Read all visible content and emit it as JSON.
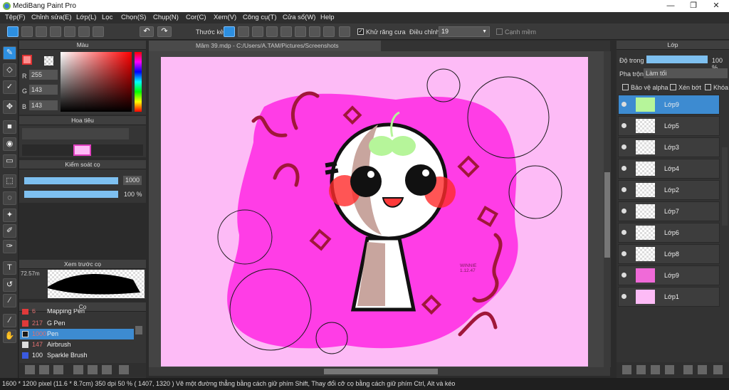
{
  "window": {
    "title": "MediBang Paint Pro",
    "min": "—",
    "max": "❐",
    "close": "✕"
  },
  "menu": [
    "Tệp(F)",
    "Chỉnh sửa(E)",
    "Lớp(L)",
    "Lọc",
    "Chọn(S)",
    "Chụp(N)",
    "Cor(C)",
    "Xem(V)",
    "Công cụ(T)",
    "Cửa sổ(W)",
    "Help"
  ],
  "toolbar": {
    "ruler_label": "Thước kẻ",
    "antialias_label": "Khử răng cưa",
    "correction_label": "Điều chỉnh",
    "correction_value": "19",
    "snap_label": "Cạnh mềm"
  },
  "color_panel": {
    "title": "Màu",
    "r_label": "R",
    "g_label": "G",
    "b_label": "B",
    "r": "255",
    "g": "143",
    "b": "143",
    "main_color": "#ff8f8f"
  },
  "navigator": {
    "title": "Hoa tiêu"
  },
  "brush_control": {
    "title": "Kiểm soát cọ",
    "size": "1000",
    "opacity": "100 %"
  },
  "brush_preview": {
    "title": "Xem trước cọ",
    "size": "72.57m"
  },
  "brush_panel": {
    "title": "Cọ",
    "items": [
      {
        "size": "6",
        "name": "Mapping Pen",
        "color": "#e03a3a"
      },
      {
        "size": "217",
        "name": "G Pen",
        "color": "#e03a3a"
      },
      {
        "size": "1000",
        "name": "Pen",
        "color": "#1b1b1b"
      },
      {
        "size": "147",
        "name": "Airbrush",
        "color": "#dddddd"
      },
      {
        "size": "100",
        "name": "Sparkle Brush",
        "color": "#3a5ae0"
      }
    ]
  },
  "document": {
    "tab": "Mâm 39.mdp - C:/Users/A.TAM/Pictures/Screenshots",
    "signature": "WINNIE 1.12.47"
  },
  "layers_panel": {
    "title": "Lớp",
    "opacity_label": "Độ trong",
    "opacity_value": "100 %",
    "blend_label": "Pha trộn",
    "blend_value": "Làm tối",
    "protect_alpha": "Bảo vệ alpha",
    "clip": "Xén bớt",
    "lock": "Khóa",
    "layers": [
      {
        "name": "Lớp9",
        "thumb": "#b6f59a"
      },
      {
        "name": "Lớp5",
        "thumb": ""
      },
      {
        "name": "Lớp3",
        "thumb": ""
      },
      {
        "name": "Lớp4",
        "thumb": ""
      },
      {
        "name": "Lớp2",
        "thumb": ""
      },
      {
        "name": "Lớp7",
        "thumb": ""
      },
      {
        "name": "Lớp6",
        "thumb": ""
      },
      {
        "name": "Lớp8",
        "thumb": ""
      },
      {
        "name": "Lớp9",
        "thumb": "#f06ad8"
      },
      {
        "name": "Lớp1",
        "thumb": "#fdbbf6"
      }
    ]
  },
  "status": "1600 * 1200 pixel   (11.6 * 8.7cm)   350 dpi   50 %   ( 1407, 1320 )   Vẽ một đường thẳng bằng cách giữ phím Shift, Thay đổi cỡ cọ bằng cách giữ phím Ctrl, Alt và kéo"
}
